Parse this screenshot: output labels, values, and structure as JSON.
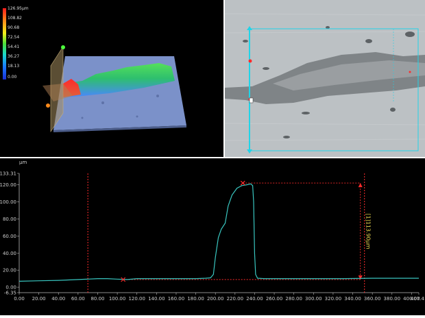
{
  "colors": {
    "background": "#000000",
    "profile_line": "#39c6c0",
    "marker": "#ff2b2b",
    "dimension_text": "#e8d44d",
    "overlay": "#20d4e8"
  },
  "height_map": {
    "scale_labels": [
      "126.95μm",
      "108.82",
      "90.68",
      "72.54",
      "54.41",
      "36.27",
      "18.13",
      "0.00"
    ]
  },
  "profile": {
    "unit_label": "μm",
    "y_tick_labels": [
      "133.31",
      "120.00",
      "100.00",
      "80.00",
      "60.00",
      "40.00",
      "20.00",
      "0.00",
      "-6.35"
    ],
    "x_tick_labels": [
      "0.00",
      "20.00",
      "40.00",
      "60.00",
      "80.00",
      "100.00",
      "120.00",
      "140.00",
      "160.00",
      "180.00",
      "200.00",
      "220.00",
      "240.00",
      "260.00",
      "280.00",
      "300.00",
      "320.00",
      "340.00",
      "360.00",
      "380.00",
      "400.00",
      "407.4"
    ],
    "measurement_label": "[1]113.90μm"
  },
  "chart_data": {
    "type": "line",
    "xlim": [
      0,
      407.4
    ],
    "ylim": [
      -6.35,
      133.31
    ],
    "x_ticks": [
      0,
      20,
      40,
      60,
      80,
      100,
      120,
      140,
      160,
      180,
      200,
      220,
      240,
      260,
      280,
      300,
      320,
      340,
      360,
      380,
      400
    ],
    "y_ticks": [
      0,
      20,
      40,
      60,
      80,
      100,
      120
    ],
    "grid": false,
    "series": [
      {
        "x": [
          0,
          20,
          40,
          60,
          80,
          90,
          100,
          110,
          120,
          140,
          160,
          180,
          190,
          195,
          198,
          200,
          203,
          206,
          210,
          213,
          217,
          222,
          227,
          232,
          236,
          238,
          239,
          240,
          241,
          243,
          250,
          270,
          300,
          330,
          360,
          390,
          407.4
        ],
        "y": [
          7,
          7.5,
          8,
          9,
          10,
          10,
          9.5,
          9,
          10,
          10,
          10,
          10,
          10.5,
          11,
          15,
          35,
          58,
          68,
          75,
          95,
          108,
          116,
          119,
          120,
          121,
          119,
          100,
          40,
          15,
          10.5,
          10,
          10,
          10,
          10,
          10.5,
          10.5,
          10.5
        ]
      }
    ],
    "cursor_lines_x": [
      70,
      352
    ],
    "markers": [
      {
        "x": 106,
        "y": 9
      },
      {
        "x": 228,
        "y": 122
      }
    ],
    "measurement": {
      "label": "[1]113.90μm",
      "from_y": 9,
      "to_y": 122
    }
  }
}
